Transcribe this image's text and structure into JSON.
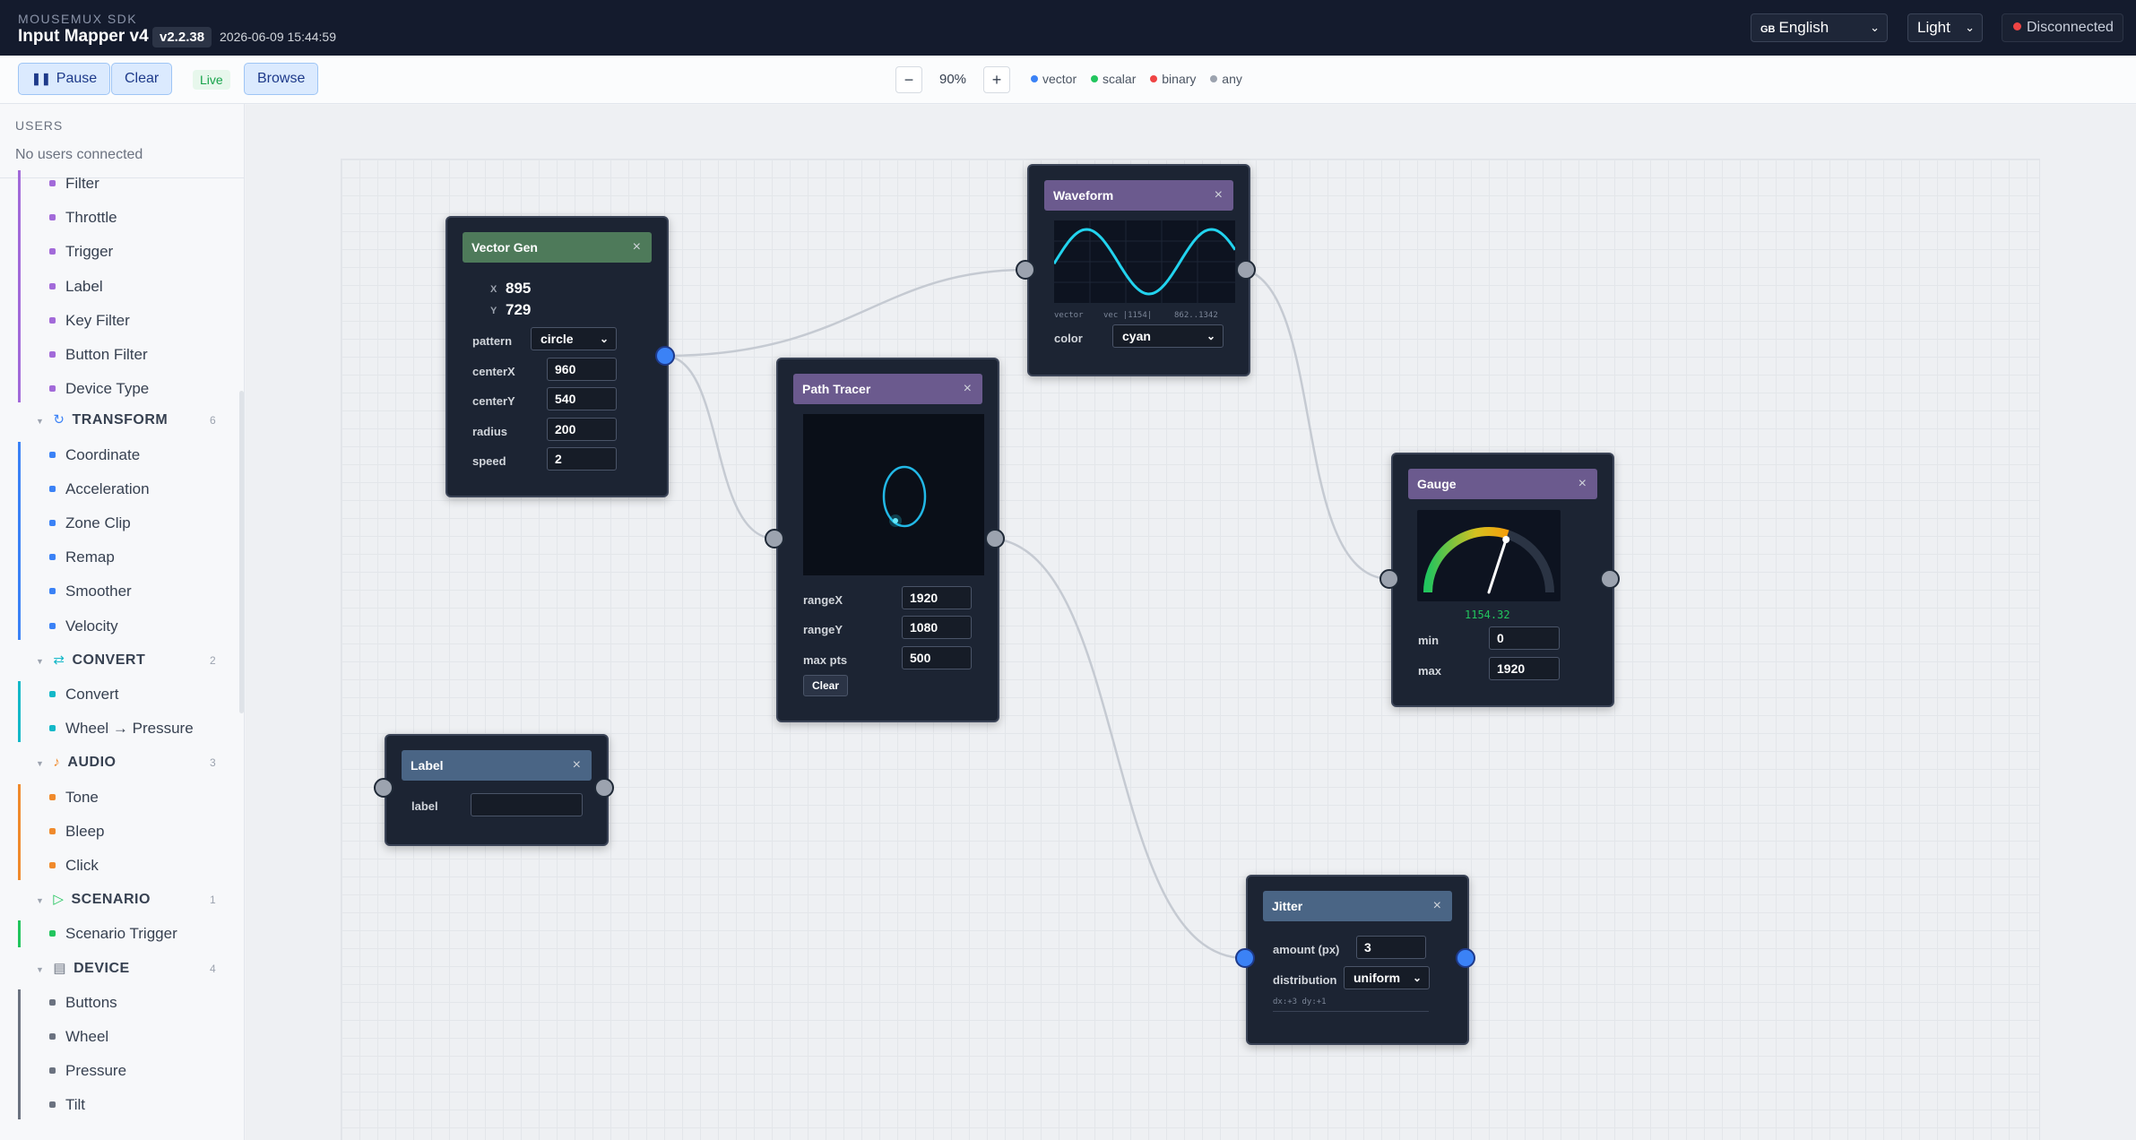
{
  "header": {
    "brand_small": "MOUSEMUX SDK",
    "title": "Input Mapper v4",
    "version": "v2.2.38",
    "timestamp": "2026-06-09 15:44:59",
    "language_flag": "GB",
    "language": "English",
    "theme": "Light",
    "connection_status": "Disconnected"
  },
  "toolbar": {
    "pause_label": "Pause",
    "clear_label": "Clear",
    "live_label": "Live",
    "browse_label": "Browse",
    "zoom_minus": "−",
    "zoom_level": "90%",
    "zoom_plus": "+",
    "legend": [
      {
        "label": "vector",
        "color": "#3b82f6"
      },
      {
        "label": "scalar",
        "color": "#22c55e"
      },
      {
        "label": "binary",
        "color": "#ef4444"
      },
      {
        "label": "any",
        "color": "#9ca3af"
      }
    ]
  },
  "sidebar": {
    "users_title": "USERS",
    "users_empty": "No users connected",
    "filter_items": [
      "Filter",
      "Throttle",
      "Trigger",
      "Label",
      "Key Filter",
      "Button Filter",
      "Device Type"
    ],
    "categories": {
      "transform": {
        "name": "TRANSFORM",
        "icon": "↻",
        "count": "6",
        "items": [
          "Coordinate",
          "Acceleration",
          "Zone Clip",
          "Remap",
          "Smoother",
          "Velocity"
        ]
      },
      "convert": {
        "name": "CONVERT",
        "icon": "⇄",
        "count": "2",
        "items": [
          "Convert",
          "Wheel → Pressure"
        ]
      },
      "audio": {
        "name": "AUDIO",
        "icon": "♪",
        "count": "3",
        "items": [
          "Tone",
          "Bleep",
          "Click"
        ]
      },
      "scenario": {
        "name": "SCENARIO",
        "icon": "▷",
        "count": "1",
        "items": [
          "Scenario Trigger"
        ]
      },
      "device": {
        "name": "DEVICE",
        "icon": "▤",
        "count": "4",
        "items": [
          "Buttons",
          "Wheel",
          "Pressure",
          "Tilt"
        ]
      }
    },
    "colors": {
      "filter": "#a26ad9",
      "transform": "#3b82f6",
      "convert": "#14b8c8",
      "audio": "#f08a2c",
      "scenario": "#22c55e",
      "device": "#6b7280"
    }
  },
  "nodes": {
    "vector_gen": {
      "title": "Vector Gen",
      "close": "×",
      "x_label": "X",
      "x_value": "895",
      "y_label": "Y",
      "y_value": "729",
      "pattern_label": "pattern",
      "pattern_value": "circle",
      "centerx_label": "centerX",
      "centerx_value": "960",
      "centery_label": "centerY",
      "centery_value": "540",
      "radius_label": "radius",
      "radius_value": "200",
      "speed_label": "speed",
      "speed_value": "2",
      "color": "#4e7a5a"
    },
    "waveform": {
      "title": "Waveform",
      "close": "×",
      "footer_left": "vector",
      "footer_mid": "vec |1154|",
      "footer_right": "862..1342",
      "color_label": "color",
      "color_value": "cyan",
      "head_color": "#6b5a8e",
      "wave_color": "#22d3ee"
    },
    "path_tracer": {
      "title": "Path Tracer",
      "close": "×",
      "rangex_label": "rangeX",
      "rangex_value": "1920",
      "rangey_label": "rangeY",
      "rangey_value": "1080",
      "maxpts_label": "max pts",
      "maxpts_value": "500",
      "clear_label": "Clear",
      "head_color": "#6b5a8e"
    },
    "gauge": {
      "title": "Gauge",
      "close": "×",
      "readout": "1154.32",
      "level": 0.6,
      "min_label": "min",
      "min_value": "0",
      "max_label": "max",
      "max_value": "1920",
      "head_color": "#6b5a8e"
    },
    "label": {
      "title": "Label",
      "close": "×",
      "label_label": "label",
      "label_value": "",
      "head_color": "#4a6585"
    },
    "jitter": {
      "title": "Jitter",
      "close": "×",
      "amount_label": "amount (px)",
      "amount_value": "3",
      "distribution_label": "distribution",
      "distribution_value": "uniform",
      "readout": "dx:+3 dy:+1",
      "head_color": "#4a6585"
    }
  }
}
